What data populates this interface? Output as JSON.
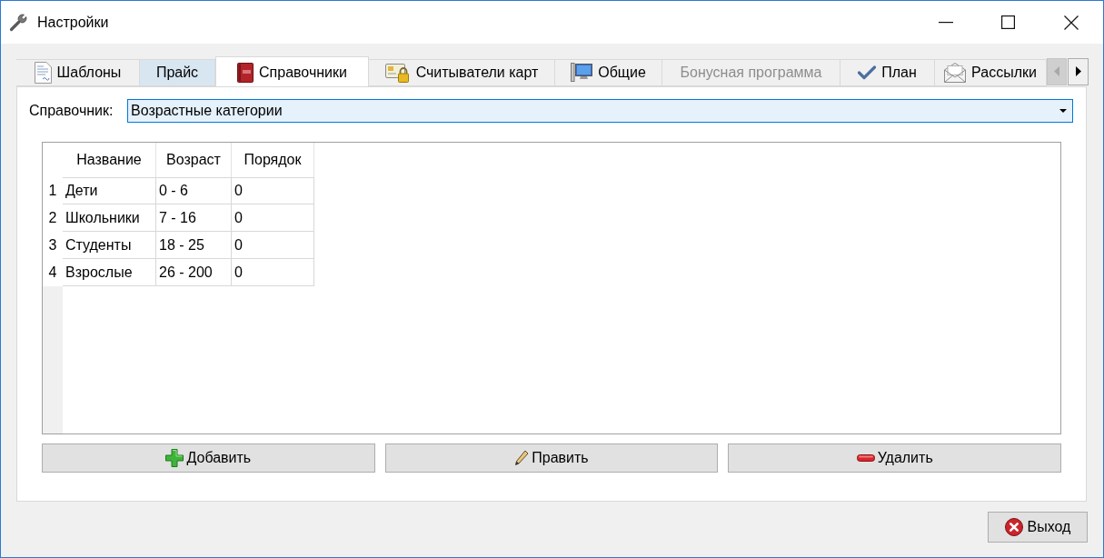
{
  "window": {
    "title": "Настройки"
  },
  "tabs": [
    {
      "label": "Шаблоны",
      "selected": false,
      "hovered": false,
      "disabled": false
    },
    {
      "label": "Прайс",
      "selected": false,
      "hovered": true,
      "disabled": false
    },
    {
      "label": "Справочники",
      "selected": true,
      "hovered": false,
      "disabled": false
    },
    {
      "label": "Считыватели карт",
      "selected": false,
      "hovered": false,
      "disabled": false
    },
    {
      "label": "Общие",
      "selected": false,
      "hovered": false,
      "disabled": false
    },
    {
      "label": "Бонусная программа",
      "selected": false,
      "hovered": false,
      "disabled": true
    },
    {
      "label": "План",
      "selected": false,
      "hovered": false,
      "disabled": false
    },
    {
      "label": "Рассылки",
      "selected": false,
      "hovered": false,
      "disabled": false
    }
  ],
  "tab_scroll": {
    "back_disabled": true,
    "forward_disabled": false
  },
  "directory": {
    "label": "Справочник:",
    "value": "Возрастные категории"
  },
  "table": {
    "columns": [
      "Название",
      "Возраст",
      "Порядок"
    ],
    "rows": [
      {
        "number": "1",
        "cells": [
          "Дети",
          "0 - 6",
          "0"
        ]
      },
      {
        "number": "2",
        "cells": [
          "Школьники",
          "7 - 16",
          "0"
        ]
      },
      {
        "number": "3",
        "cells": [
          "Студенты",
          "18 - 25",
          "0"
        ]
      },
      {
        "number": "4",
        "cells": [
          "Взрослые",
          "26 - 200",
          "0"
        ]
      }
    ]
  },
  "actions": [
    "Добавить",
    "Править",
    "Удалить"
  ],
  "exit_button": "Выход"
}
